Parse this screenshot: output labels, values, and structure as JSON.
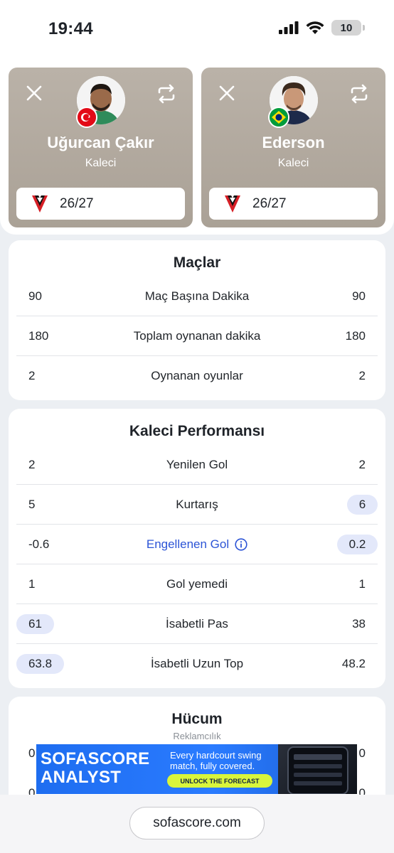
{
  "status_bar": {
    "time": "19:44",
    "battery": "10"
  },
  "players": [
    {
      "name": "Uğurcan Çakır",
      "position": "Kaleci",
      "season": "26/27",
      "flag": "turkey-flag-icon"
    },
    {
      "name": "Ederson",
      "position": "Kaleci",
      "season": "26/27",
      "flag": "brazil-flag-icon"
    }
  ],
  "matches": {
    "title": "Maçlar",
    "rows": [
      {
        "label": "Maç Başına Dakika",
        "left": "90",
        "right": "90"
      },
      {
        "label": "Toplam oynanan dakika",
        "left": "180",
        "right": "180"
      },
      {
        "label": "Oynanan oyunlar",
        "left": "2",
        "right": "2"
      }
    ]
  },
  "goalkeeping": {
    "title": "Kaleci Performansı",
    "rows": [
      {
        "label": "Yenilen Gol",
        "left": "2",
        "right": "2",
        "highlight": "none"
      },
      {
        "label": "Kurtarış",
        "left": "5",
        "right": "6",
        "highlight": "right"
      },
      {
        "label": "Engellenen Gol",
        "left": "-0.6",
        "right": "0.2",
        "highlight": "right",
        "info": true
      },
      {
        "label": "Gol yemedi",
        "left": "1",
        "right": "1",
        "highlight": "none"
      },
      {
        "label": "İsabetli Pas",
        "left": "61",
        "right": "38",
        "highlight": "left"
      },
      {
        "label": "İsabetli Uzun Top",
        "left": "63.8",
        "right": "48.2",
        "highlight": "left"
      }
    ]
  },
  "attack": {
    "title": "Hücum",
    "ad_label": "Reklamcılık",
    "partial_left": "0",
    "partial_right": "0",
    "partial_left_2": "0",
    "partial_right_2": "0"
  },
  "ad": {
    "brand_line1": "SOFASCORE",
    "brand_line2": "ANALYST",
    "text_line1": "Every hardcourt swing",
    "text_line2": "match, fully covered.",
    "cta": "UNLOCK THE FORECAST"
  },
  "browser": {
    "url": "sofascore.com"
  },
  "colors": {
    "accent": "#2c54d6",
    "highlight_pill": "#e3e8fa",
    "card_bg": "#b3aba0"
  }
}
